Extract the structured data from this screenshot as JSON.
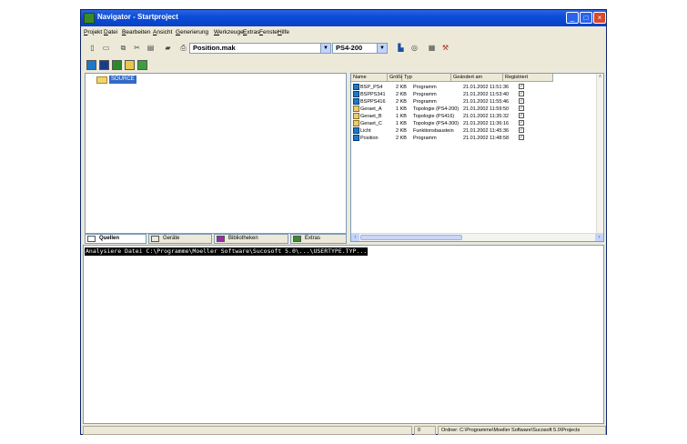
{
  "window": {
    "title": "Navigator - Startproject",
    "controls": {
      "minimize": "_",
      "maximize": "□",
      "close": "×"
    }
  },
  "menu": [
    {
      "label": "Projekt",
      "ul": "P"
    },
    {
      "label": "Datei",
      "ul": "D"
    },
    {
      "label": "Bearbeiten",
      "ul": "B"
    },
    {
      "label": "Ansicht",
      "ul": "A"
    },
    {
      "label": "Generierung",
      "ul": "G"
    },
    {
      "label": "Werkzeuge",
      "ul": "W"
    },
    {
      "label": "Extras",
      "ul": "E"
    },
    {
      "label": "Fenster",
      "ul": "F"
    },
    {
      "label": "Hilfe",
      "ul": "H"
    }
  ],
  "toolbar": {
    "file_combo": "Position.mak",
    "target_combo": "PS4-200",
    "icons": [
      "new-icon",
      "open-icon",
      "copy-icon",
      "cut-icon",
      "paste-icon",
      "folder-icon",
      "print-icon"
    ],
    "right_icons": [
      "build-icon",
      "network-icon",
      "properties-icon",
      "tools-icon"
    ]
  },
  "toolbar2": {
    "icons": [
      {
        "name": "program-icon",
        "color": "#1e78c8"
      },
      {
        "name": "module-icon",
        "color": "#1a3c8c"
      },
      {
        "name": "function-icon",
        "color": "#2a8a2a"
      },
      {
        "name": "topology-icon",
        "color": "#e6c84a"
      },
      {
        "name": "network-view-icon",
        "color": "#3aa03a"
      }
    ]
  },
  "tree": {
    "root": "SOURCE"
  },
  "tabs": [
    {
      "label": "Quellen",
      "active": true
    },
    {
      "label": "Geräte",
      "active": false
    },
    {
      "label": "Bibliotheken",
      "active": false
    },
    {
      "label": "Extras",
      "active": false
    }
  ],
  "file_list": {
    "headers": [
      "Name",
      "Größe",
      "Typ",
      "Geändert am",
      "Registriert"
    ],
    "rows": [
      {
        "name": "BSP_PS4",
        "size": "2 KB",
        "type": "Programm",
        "date": "21.01.2002 11:51:36",
        "icon": "prog"
      },
      {
        "name": "BSPPS341",
        "size": "2 KB",
        "type": "Programm",
        "date": "21.01.2002 11:53:40",
        "icon": "prog"
      },
      {
        "name": "BSPPS416",
        "size": "2 KB",
        "type": "Programm",
        "date": "21.01.2002 11:55:46",
        "icon": "prog"
      },
      {
        "name": "Geraet_A",
        "size": "1 KB",
        "type": "Topologie (PS4-200)",
        "date": "21.01.2002 11:59:50",
        "icon": "topo"
      },
      {
        "name": "Geraet_B",
        "size": "1 KB",
        "type": "Topologie (PS416)",
        "date": "21.01.2002 11:35:32",
        "icon": "topo"
      },
      {
        "name": "Geraet_C",
        "size": "1 KB",
        "type": "Topologie (PS4-300)",
        "date": "21.01.2002 11:36:16",
        "icon": "topo"
      },
      {
        "name": "Licht",
        "size": "2 KB",
        "type": "Funktionsbaustein",
        "date": "21.01.2002 11:45:36",
        "icon": "prog"
      },
      {
        "name": "Position",
        "size": "2 KB",
        "type": "Programm",
        "date": "21.01.2002 11:48:58",
        "icon": "prog"
      }
    ]
  },
  "output": {
    "line": "Analysiere Datei C:\\Programme\\Moeller Software\\Sucosoft 5.0\\...\\USERTYPE.TYP..."
  },
  "status": {
    "count": "0",
    "folder": "Ordner: C:\\Programme\\Moeller Software\\Sucosoft 5.0\\Projects"
  }
}
